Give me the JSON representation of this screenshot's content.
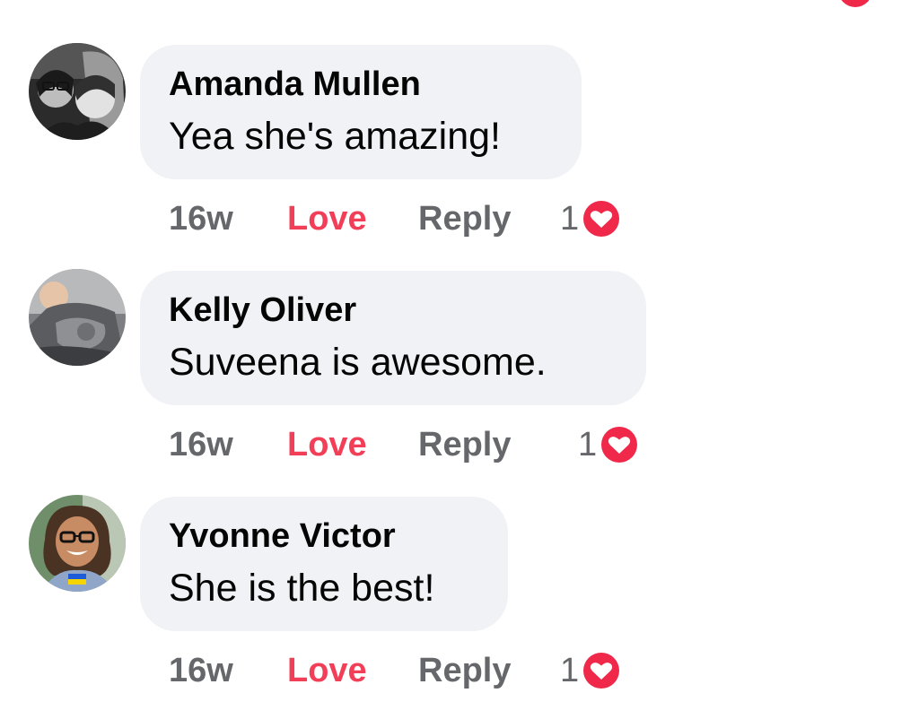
{
  "comments": [
    {
      "author": "Amanda Mullen",
      "text": "Yea she's amazing!",
      "time": "16w",
      "love_label": "Love",
      "reply_label": "Reply",
      "reaction_count": "1"
    },
    {
      "author": "Kelly Oliver",
      "text": "Suveena is awesome.",
      "time": "16w",
      "love_label": "Love",
      "reply_label": "Reply",
      "reaction_count": "1"
    },
    {
      "author": "Yvonne Victor",
      "text": "She is the best!",
      "time": "16w",
      "love_label": "Love",
      "reply_label": "Reply",
      "reaction_count": "1"
    }
  ],
  "colors": {
    "bubble": "#f0f2f5",
    "love": "#f33e58",
    "muted": "#65676b",
    "heart": "#f0284a"
  },
  "icons": {
    "reaction": "heart-icon"
  }
}
